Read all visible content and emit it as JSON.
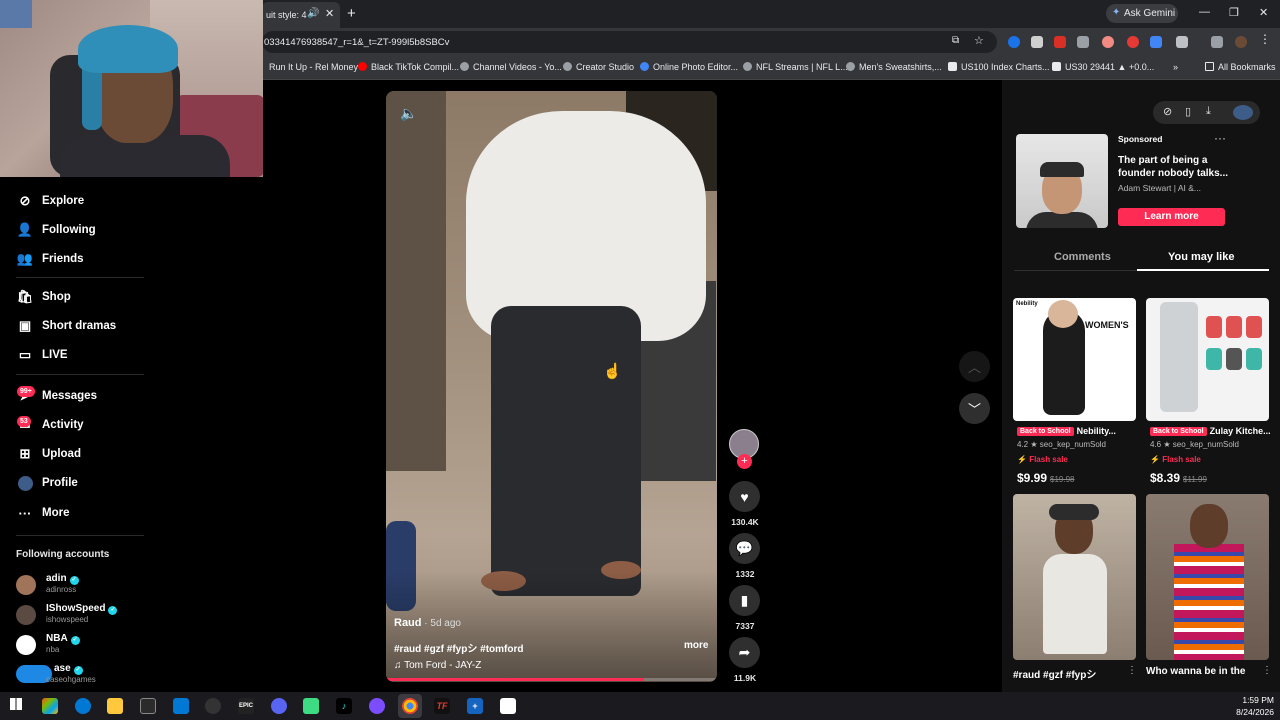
{
  "browser": {
    "tab_title": "uit style: 4",
    "url": "03341476938547_r=1&_t=ZT-999l5b8SBCv",
    "ask_gemini": "Ask Gemini",
    "all_bookmarks": "All Bookmarks",
    "bookmarks": [
      "Run It Up - Rel Money",
      "Black TikTok Compil...",
      "Channel Videos - Yo...",
      "Creator Studio",
      "Online Photo Editor...",
      "NFL Streams | NFL L...",
      "Men's Sweatshirts,...",
      "US100 Index Charts...",
      "US30 29441 ▲ +0.0..."
    ]
  },
  "sidebar": {
    "items": [
      {
        "label": "Explore",
        "icon": "compass-icon"
      },
      {
        "label": "Following",
        "icon": "following-icon"
      },
      {
        "label": "Friends",
        "icon": "friends-icon"
      },
      {
        "label": "Shop",
        "icon": "shop-icon"
      },
      {
        "label": "Short dramas",
        "icon": "film-icon"
      },
      {
        "label": "LIVE",
        "icon": "live-icon"
      },
      {
        "label": "Messages",
        "icon": "send-icon",
        "badge": "99+"
      },
      {
        "label": "Activity",
        "icon": "inbox-icon",
        "badge": "53"
      },
      {
        "label": "Upload",
        "icon": "plus-square-icon"
      },
      {
        "label": "Profile",
        "icon": "avatar-icon"
      },
      {
        "label": "More",
        "icon": "dots-icon"
      }
    ],
    "following_title": "Following accounts",
    "accounts": [
      {
        "name": "adin",
        "handle": "adinross"
      },
      {
        "name": "IShowSpeed",
        "handle": "ishowspeed"
      },
      {
        "name": "NBA",
        "handle": "nba"
      },
      {
        "name": "ase",
        "handle": "caseohgames"
      }
    ]
  },
  "video": {
    "author": "Raud",
    "time": " · 5d ago",
    "tags": "#raud #gzf #fypシ #tomford",
    "more": "more",
    "music": "Tom Ford - JAY-Z",
    "progress": 0.78,
    "likes": "130.4K",
    "comments": "1332",
    "saves": "7337",
    "shares": "11.9K"
  },
  "right": {
    "sponsored": "Sponsored",
    "ad_title": "The part of being a founder nobody talks...",
    "ad_author": "Adam Stewart | AI &...",
    "cta": "Learn more",
    "tab_comments": "Comments",
    "tab_you_may_like": "You may like",
    "products": [
      {
        "badge": "Back to School",
        "title": "Nebility...",
        "rating": "4.2 ★ seo_kep_numSold",
        "sale": "Flash sale",
        "price": "$9.99",
        "old": "$19.98",
        "img_text": "WOMEN'S"
      },
      {
        "badge": "Back to School",
        "title": "Zulay Kitche...",
        "rating": "4.6 ★ seo_kep_numSold",
        "sale": "Flash sale",
        "price": "$8.39",
        "old": "$11.99",
        "img_text": ""
      }
    ],
    "videos": [
      {
        "caption": "#raud #gzf #fypシ"
      },
      {
        "caption": "Who wanna be in the"
      }
    ]
  },
  "taskbar": {
    "time": "1:59 PM",
    "date": "8/24/2026"
  },
  "colors": {
    "accent": "#fe2c55",
    "verified": "#20d5ec"
  }
}
